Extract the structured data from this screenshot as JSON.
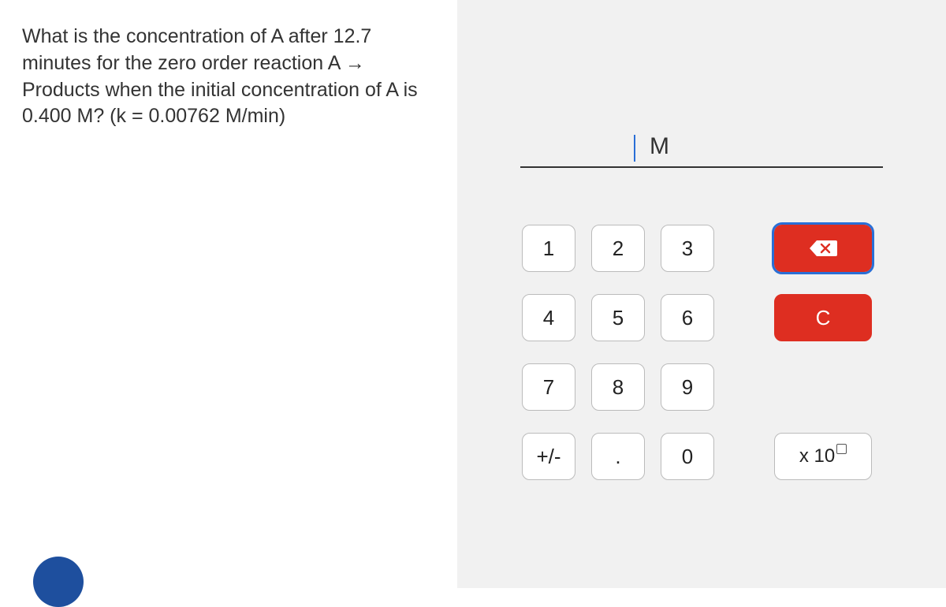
{
  "question": {
    "text": "What is the concentration of A after 12.7 minutes for the zero order reaction A → Products when the initial concentration of A is 0.400 M? (k = 0.00762 M/min)"
  },
  "answer": {
    "value": "",
    "unit": "M"
  },
  "keypad": {
    "k1": "1",
    "k2": "2",
    "k3": "3",
    "k4": "4",
    "k5": "5",
    "k6": "6",
    "k7": "7",
    "k8": "8",
    "k9": "9",
    "sign": "+/-",
    "dot": ".",
    "k0": "0",
    "clear": "C",
    "sci_prefix": "x 10"
  }
}
